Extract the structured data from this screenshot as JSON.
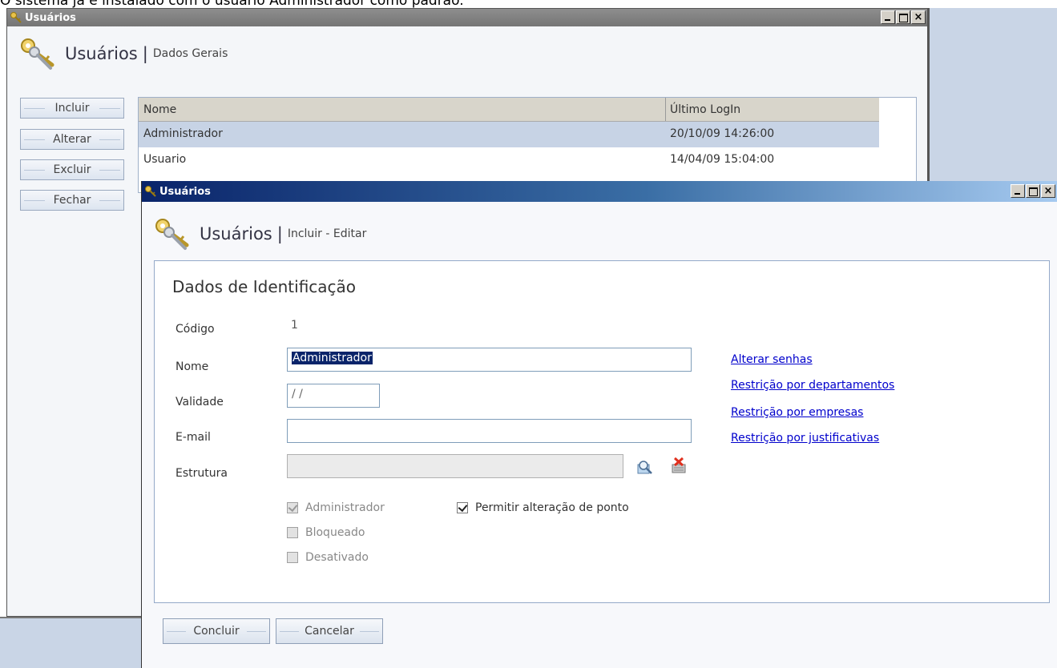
{
  "caption": "O sistema já é instalado com o usuário Administrador como padrão.",
  "back_window": {
    "title": "Usuários",
    "header": {
      "title": "Usuários",
      "separator": "|",
      "subtitle": "Dados Gerais"
    },
    "buttons": {
      "incluir": "Incluir",
      "alterar": "Alterar",
      "excluir": "Excluir",
      "fechar": "Fechar"
    },
    "grid": {
      "columns": [
        "Nome",
        "Último LogIn"
      ],
      "rows": [
        {
          "nome": "Administrador",
          "ultimo_login": "20/10/09 14:26:00",
          "selected": true
        },
        {
          "nome": "Usuario",
          "ultimo_login": "14/04/09 15:04:00",
          "selected": false
        }
      ]
    }
  },
  "front_window": {
    "title": "Usuários",
    "header": {
      "title": "Usuários",
      "separator": "|",
      "subtitle": "Incluir - Editar"
    },
    "section_title": "Dados de Identificação",
    "labels": {
      "codigo": "Código",
      "nome": "Nome",
      "validade": "Validade",
      "email": "E-mail",
      "estrutura": "Estrutura"
    },
    "values": {
      "codigo": "1",
      "nome": "Administrador",
      "validade": " / /",
      "email": "",
      "estrutura": ""
    },
    "checkboxes": {
      "administrador": {
        "label": "Administrador",
        "checked": true,
        "enabled": false
      },
      "bloqueado": {
        "label": "Bloqueado",
        "checked": false,
        "enabled": false
      },
      "desativado": {
        "label": "Desativado",
        "checked": false,
        "enabled": false
      },
      "permitir_ponto": {
        "label": "Permitir alteração de ponto",
        "checked": true,
        "enabled": true
      }
    },
    "links": {
      "alterar_senhas": "Alterar senhas",
      "restricao_departamentos": "Restrição por departamentos",
      "restricao_empresas": "Restrição por empresas",
      "restricao_justificativas": "Restrição por justificativas"
    },
    "buttons": {
      "concluir": "Concluir",
      "cancelar": "Cancelar"
    },
    "icons": {
      "estrutura_select": "search-structure-icon",
      "estrutura_clear": "clear-structure-icon"
    }
  },
  "colors": {
    "selected_row": "#c7d3e5",
    "front_titlebar_start": "#0a246a",
    "front_titlebar_end": "#a6caf0",
    "link": "#0000cc",
    "desktop": "#c9d5e6"
  }
}
